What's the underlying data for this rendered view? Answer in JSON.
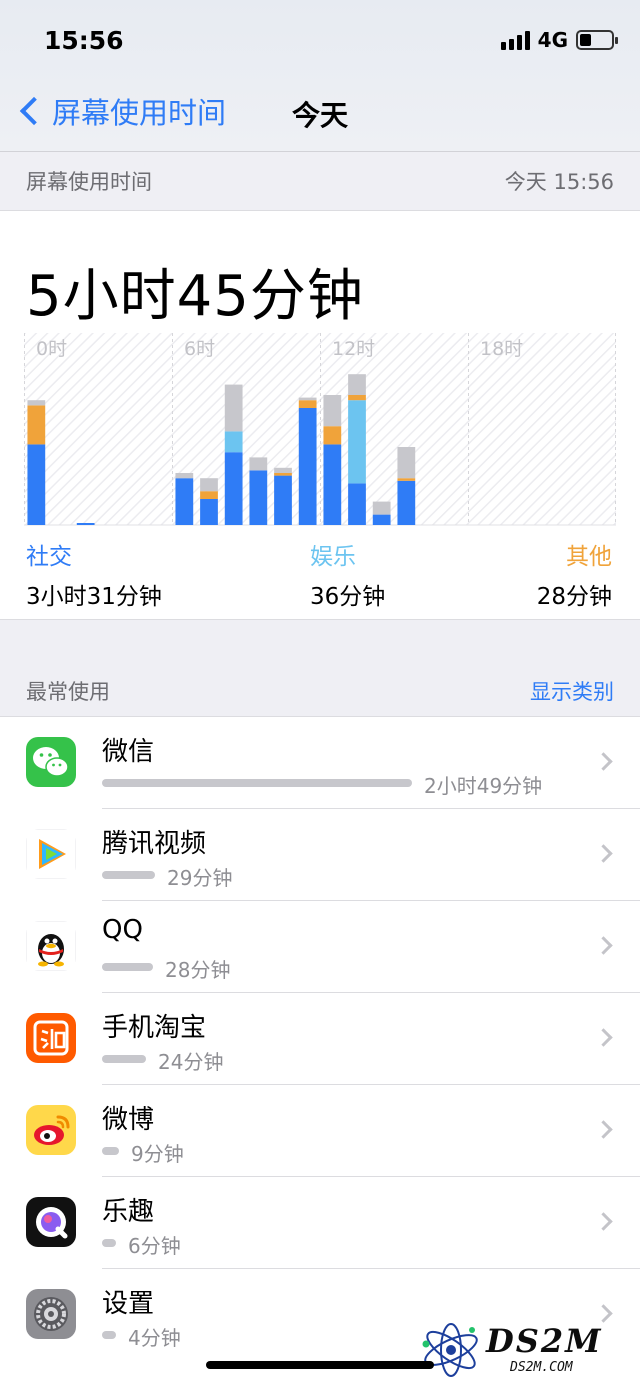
{
  "status": {
    "time": "15:56",
    "network": "4G",
    "battery_level": 0.35
  },
  "nav": {
    "back_label": "屏幕使用时间",
    "title": "今天"
  },
  "summary_header": {
    "label": "屏幕使用时间",
    "updated": "今天 15:56"
  },
  "summary": {
    "total": "5小时45分钟",
    "categories": [
      {
        "label": "社交",
        "value": "3小时31分钟",
        "color": "#2f7cf6"
      },
      {
        "label": "娱乐",
        "value": "36分钟",
        "color": "#6cc4f0"
      },
      {
        "label": "其他",
        "value": "28分钟",
        "color": "#f0a33a"
      }
    ]
  },
  "chart_data": {
    "type": "bar",
    "stacked": true,
    "tick_labels": [
      "0时",
      "6时",
      "12时",
      "18时"
    ],
    "hours": [
      0,
      1,
      2,
      3,
      4,
      5,
      6,
      7,
      8,
      9,
      10,
      11,
      12,
      13,
      14,
      15,
      16,
      17,
      18,
      19,
      20,
      21,
      22,
      23
    ],
    "ymax": 60,
    "series": [
      {
        "color": "#2f7cf6",
        "values": [
          31,
          0,
          0,
          0,
          0,
          0,
          18,
          10,
          28,
          21,
          19,
          45,
          31,
          16,
          4,
          17,
          0,
          0,
          0,
          0,
          0,
          0,
          0,
          0
        ]
      },
      {
        "color": "#6cc4f0",
        "values": [
          0,
          0,
          0,
          0,
          0,
          0,
          0,
          0,
          8,
          0,
          0,
          0,
          0,
          32,
          0,
          0,
          0,
          0,
          0,
          0,
          0,
          0,
          0,
          0
        ]
      },
      {
        "color": "#f0a33a",
        "values": [
          15,
          0,
          0,
          0,
          0,
          0,
          0,
          3,
          0,
          0,
          1,
          3,
          7,
          2,
          0,
          1,
          0,
          0,
          0,
          0,
          0,
          0,
          0,
          0
        ]
      },
      {
        "color": "#c7c7cc",
        "values": [
          2,
          0,
          0,
          0,
          0,
          0,
          2,
          5,
          18,
          5,
          2,
          1,
          12,
          8,
          5,
          12,
          0,
          0,
          0,
          0,
          0,
          0,
          0,
          0
        ]
      }
    ]
  },
  "most_used_header": {
    "label": "最常使用",
    "action": "显示类别"
  },
  "apps": [
    {
      "name": "微信",
      "duration": "2小时49分钟",
      "minutes": 169,
      "icon": "wechat-icon"
    },
    {
      "name": "腾讯视频",
      "duration": "29分钟",
      "minutes": 29,
      "icon": "tencent-video-icon"
    },
    {
      "name": "QQ",
      "duration": "28分钟",
      "minutes": 28,
      "icon": "qq-icon"
    },
    {
      "name": "手机淘宝",
      "duration": "24分钟",
      "minutes": 24,
      "icon": "taobao-icon"
    },
    {
      "name": "微博",
      "duration": "9分钟",
      "minutes": 9,
      "icon": "weibo-icon"
    },
    {
      "name": "乐趣",
      "duration": "6分钟",
      "minutes": 6,
      "icon": "lequ-icon"
    },
    {
      "name": "设置",
      "duration": "4分钟",
      "minutes": 4,
      "icon": "settings-icon"
    }
  ],
  "watermark": {
    "text": "DS2M",
    "sub": "DS2M.COM"
  }
}
